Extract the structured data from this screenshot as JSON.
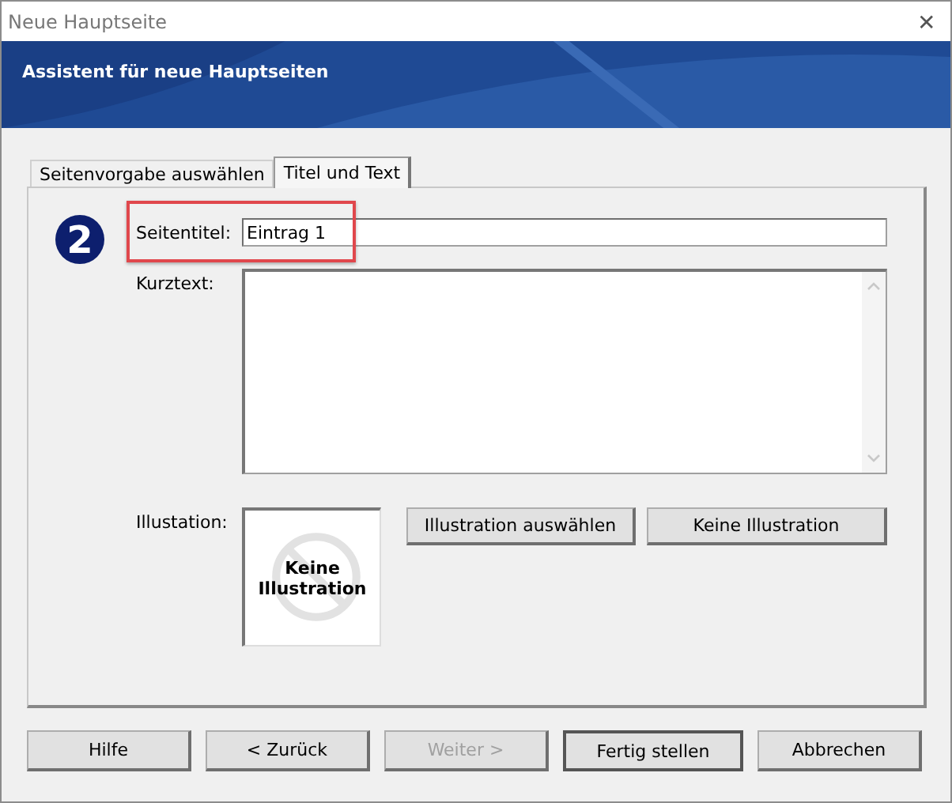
{
  "window": {
    "title": "Neue Hauptseite",
    "close": "✕"
  },
  "banner": {
    "title": "Assistent für neue Hauptseiten"
  },
  "tabs": [
    {
      "label": "Seitenvorgabe auswählen",
      "selected": false
    },
    {
      "label": "Titel und Text",
      "selected": true
    }
  ],
  "step": "2",
  "form": {
    "title_label": "Seitentitel:",
    "title_value": "Eintrag 1",
    "highlighted": true,
    "summary_label": "Kurztext:",
    "illustration_label": "Illustation:",
    "preview_text": "Keine Illustration",
    "buttons": [
      {
        "label": "Illustration auswählen",
        "disabled": false
      },
      {
        "label": "Keine Illustration",
        "disabled": false
      }
    ]
  },
  "footer_buttons": [
    {
      "label": "Hilfe",
      "disabled": false,
      "default": false
    },
    {
      "label": "< Zurück",
      "disabled": false,
      "default": false
    },
    {
      "label": "Weiter >",
      "disabled": true,
      "default": false
    },
    {
      "label": "Fertig stellen",
      "disabled": false,
      "default": true
    },
    {
      "label": "Abbrechen",
      "disabled": false,
      "default": false
    }
  ]
}
